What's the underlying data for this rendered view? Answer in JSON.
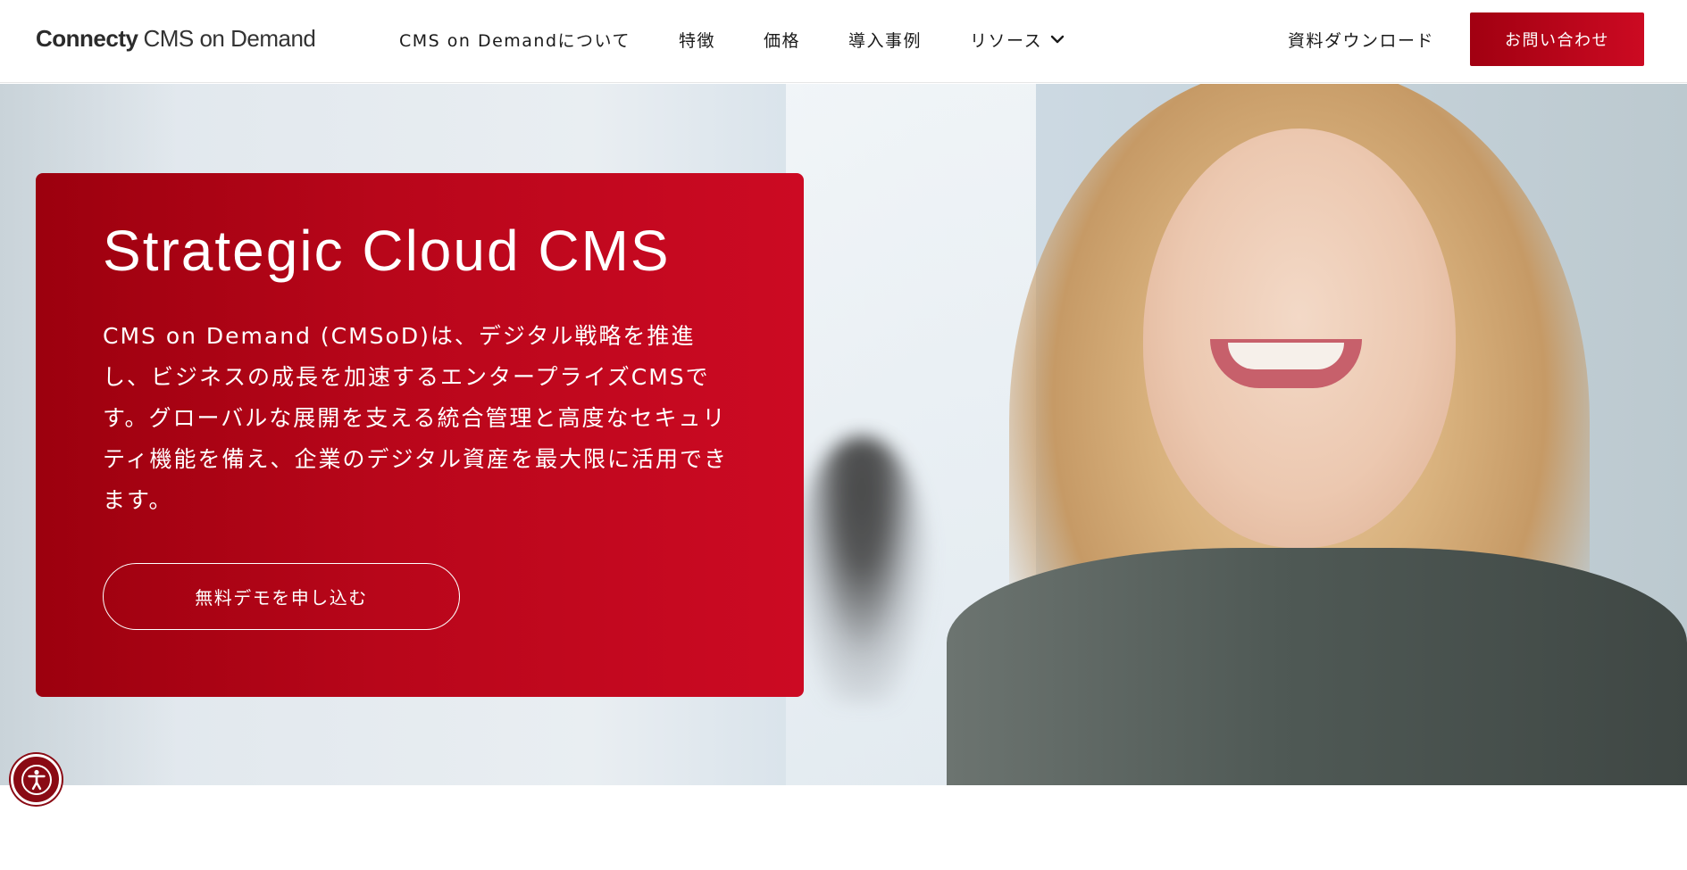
{
  "header": {
    "logo_bold": "Connecty",
    "logo_light": "CMS on Demand",
    "nav": [
      {
        "label": "CMS on Demandについて"
      },
      {
        "label": "特徴"
      },
      {
        "label": "価格"
      },
      {
        "label": "導入事例"
      },
      {
        "label": "リソース",
        "icon": "chevron-down-icon"
      }
    ],
    "download_label": "資料ダウンロード",
    "contact_label": "お問い合わせ"
  },
  "hero": {
    "title": "Strategic Cloud CMS",
    "description": "CMS on Demand (CMSoD)は、デジタル戦略を推進し、ビジネスの成長を加速するエンタープライズCMSです。グローバルな展開を支える統合管理と高度なセキュリティ機能を備え、企業のデジタル資産を最大限に活用できます。",
    "cta_label": "無料デモを申し込む"
  },
  "accessibility": {
    "icon": "accessibility-icon"
  },
  "colors": {
    "brand_red_dark": "#9c000e",
    "brand_red_light": "#cc0a23",
    "text_dark": "#1a1a1a",
    "white": "#ffffff"
  }
}
